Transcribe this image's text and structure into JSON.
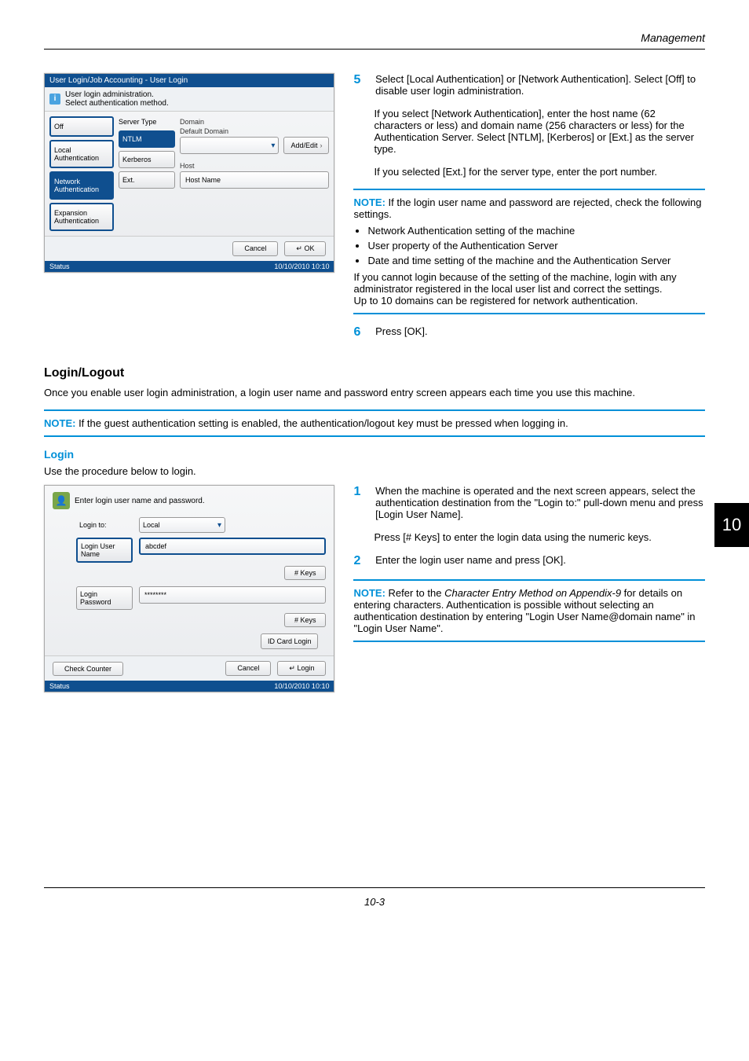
{
  "header": {
    "section_title": "Management"
  },
  "panel1": {
    "titlebar": "User Login/Job Accounting - User Login",
    "subbar_line1": "User login administration.",
    "subbar_line2": "Select authentication method.",
    "side": {
      "off": "Off",
      "local": "Local Authentication",
      "network": "Network Authentication",
      "expansion": "Expansion Authentication"
    },
    "server_type_label": "Server Type",
    "serv": {
      "ntlm": "NTLM",
      "kerberos": "Kerberos",
      "ext": "Ext."
    },
    "domain_label": "Domain",
    "default_domain_label": "Default Domain",
    "add_edit": "Add/Edit",
    "host_label": "Host",
    "hostname_label": "Host Name",
    "cancel": "Cancel",
    "ok": "OK",
    "status": "Status",
    "timestamp": "10/10/2010  10:10"
  },
  "steps": {
    "s5_text": "Select [Local Authentication] or [Network Authentication]. Select [Off] to disable user login administration.",
    "s5_para2": "If you select [Network Authentication], enter the host name (62 characters or less) and domain name (256 characters or less) for the Authentication Server. Select [NTLM], [Kerberos] or [Ext.] as the server type.",
    "s5_para3": "If you selected [Ext.] for the server type, enter the port number.",
    "s6_text": "Press [OK]."
  },
  "note1": {
    "label": "NOTE:",
    "intro": " If the login user name and password are rejected, check the following settings.",
    "b1": "Network Authentication setting of the machine",
    "b2": "User property of the Authentication Server",
    "b3": "Date and time setting of the machine and the Authentication Server",
    "tail1": "If you cannot login because of the setting of the machine, login with any administrator registered in the local user list and correct the settings.",
    "tail2": "Up to 10 domains can be registered for network authentication."
  },
  "login_section": {
    "heading": "Login/Logout",
    "intro": "Once you enable user login administration, a login user name and password entry screen appears each time you use this machine."
  },
  "note2": {
    "label": "NOTE:",
    "text": " If the guest authentication setting is enabled, the authentication/logout key must be pressed when logging in."
  },
  "login_sub": {
    "heading": "Login",
    "intro": "Use the procedure below to login."
  },
  "panel2": {
    "head": "Enter login user name and password.",
    "login_to_label": "Login to:",
    "login_to_value": "Local",
    "login_user_name_label": "Login User Name",
    "username_value": "abcdef",
    "login_password_label": "Login Password",
    "password_value": "********",
    "keys": "# Keys",
    "id_card": "ID Card Login",
    "check_counter": "Check Counter",
    "cancel": "Cancel",
    "login": "Login",
    "status": "Status",
    "timestamp": "10/10/2010  10:10"
  },
  "rsteps": {
    "s1a": "When the machine is operated and the next screen appears, select the authentication destination from the \"Login to:\" pull-down menu and press [Login User Name].",
    "s1b": "Press [# Keys] to enter the login data using the numeric keys.",
    "s2": "Enter the login user name and press [OK]."
  },
  "note3": {
    "label": "NOTE:",
    "text_a": " Refer to the ",
    "text_italic": "Character Entry Method on Appendix-9",
    "text_b": " for details on entering characters. Authentication is possible without selecting an authentication destination by entering \"Login User Name@domain name\" in \"Login User Name\"."
  },
  "page_tab": "10",
  "footer": "10-3"
}
